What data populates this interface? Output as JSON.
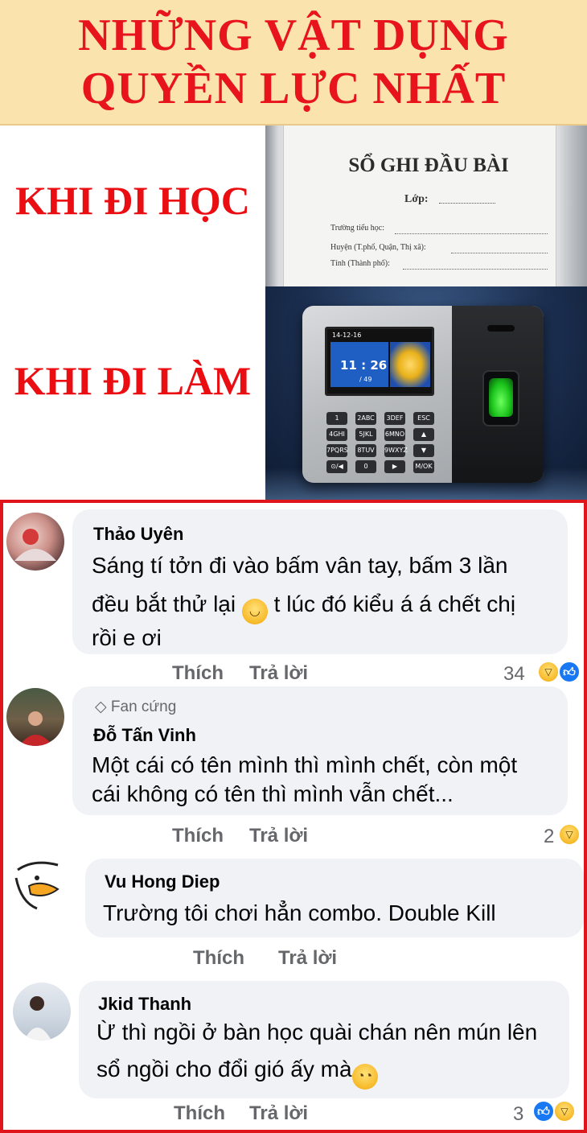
{
  "banner": {
    "line1": "NHỮNG VẬT DỤNG",
    "line2": "QUYỀN LỰC NHẤT"
  },
  "labels": {
    "school": "KHI ĐI HỌC",
    "work": "KHI ĐI LÀM"
  },
  "book": {
    "title": "SỔ GHI ĐẦU BÀI",
    "class_label": "Lớp:",
    "field_school": "Trường tiểu học:",
    "field_district": "Huyện (T.phố, Quận, Thị xã):",
    "field_province": "Tỉnh (Thành phố):"
  },
  "device": {
    "date": "14-12-16",
    "time": "11 : 26",
    "sub": "/ 49",
    "keys": [
      "1",
      "2ABC",
      "3DEF",
      "ESC",
      "4GHI",
      "5JKL",
      "6MNO",
      "▲",
      "7PQRS",
      "8TUV",
      "9WXYZ",
      "▼",
      "⊙/◀",
      "0",
      "▶",
      "M/OK"
    ]
  },
  "comments": [
    {
      "author": "Thảo Uyên",
      "lines": [
        "Sáng tí tởn đi vào bấm vân tay, bấm 3 lần",
        "đều bắt thử lại",
        "t lúc đó kiểu á á chết chị",
        "rồi e ơi"
      ],
      "emoji": "slightly-smiling-face-icon",
      "like_label": "Thích",
      "reply_label": "Trả lời",
      "reaction_count": "34",
      "reactions": [
        "haha",
        "like"
      ]
    },
    {
      "badge": "Fan cứng",
      "author": "Đỗ Tấn Vinh",
      "lines": [
        "Một cái có tên mình thì mình chết, còn một",
        "cái không có tên thì mình vẫn chết..."
      ],
      "like_label": "Thích",
      "reply_label": "Trả lời",
      "reaction_count": "2",
      "reactions": [
        "haha"
      ]
    },
    {
      "author": "Vu Hong Diep",
      "lines": [
        "Trường tôi chơi hẳn combo. Double Kill"
      ],
      "like_label": "Thích",
      "reply_label": "Trả lời"
    },
    {
      "author": "Jkid Thanh",
      "lines": [
        "Ừ thì ngồi ở bàn học quài chán nên mún lên",
        "sổ ngồi cho đổi gió ấy mà"
      ],
      "emoji": "face-with-rolling-eyes-icon",
      "like_label": "Thích",
      "reply_label": "Trả lời",
      "reaction_count": "3",
      "reactions": [
        "like",
        "haha"
      ]
    }
  ],
  "colors": {
    "banner_bg": "#fbe3ad",
    "title_red": "#e8141c",
    "frame_red": "#e0151b",
    "bubble_bg": "#f0f2f5",
    "secondary_text": "#65676b",
    "like_blue": "#1877f2",
    "haha_yellow": "#f7b928"
  }
}
